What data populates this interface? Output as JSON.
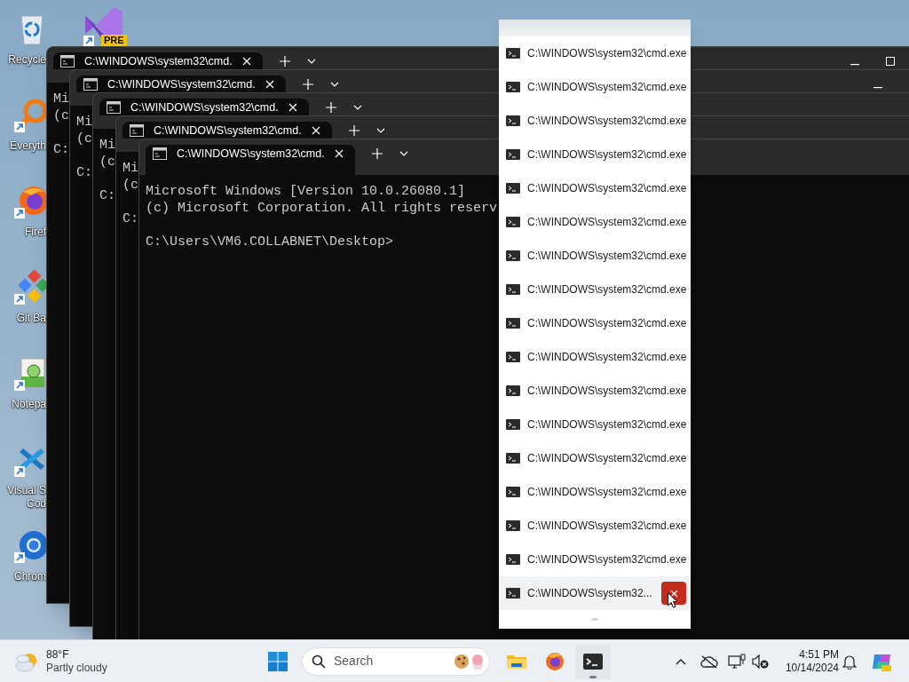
{
  "desktop_icons": [
    {
      "kind": "bin",
      "label": "Recycle",
      "shortcut": false
    },
    {
      "kind": "magnifier",
      "label": "Everyth",
      "shortcut": true
    },
    {
      "kind": "browser",
      "label": "Firef",
      "shortcut": true
    },
    {
      "kind": "git",
      "label": "Git Ba",
      "shortcut": true
    },
    {
      "kind": "notepad",
      "label": "Notepa",
      "shortcut": true
    },
    {
      "kind": "editor",
      "label": "Visual S",
      "label_line_2": "Cod",
      "shortcut": true
    },
    {
      "kind": "globe",
      "label": "Chrom",
      "shortcut": true
    }
  ],
  "second_column_icons": [
    {
      "kind": "studio",
      "badge": "PRE",
      "shortcut": true
    }
  ],
  "terminal_windows": [
    {
      "tab_title": "C:\\WINDOWS\\system32\\cmd.",
      "lines": [
        {
          "kind": "output",
          "text": "Mi"
        },
        {
          "kind": "output",
          "text": "(c"
        },
        {
          "kind": "prompt",
          "text": "C:"
        }
      ]
    },
    {
      "tab_title": "C:\\WINDOWS\\system32\\cmd.",
      "lines": [
        {
          "kind": "output",
          "text": "Mi"
        },
        {
          "kind": "output",
          "text": "(c"
        },
        {
          "kind": "prompt",
          "text": "C:"
        }
      ]
    },
    {
      "tab_title": "C:\\WINDOWS\\system32\\cmd.",
      "lines": [
        {
          "kind": "output",
          "text": "Mi"
        },
        {
          "kind": "output",
          "text": "(c"
        },
        {
          "kind": "prompt",
          "text": "C:"
        }
      ]
    },
    {
      "tab_title": "C:\\WINDOWS\\system32\\cmd.",
      "lines": [
        {
          "kind": "output",
          "text": "Mi"
        },
        {
          "kind": "output",
          "text": "(c"
        },
        {
          "kind": "prompt",
          "text": "C:"
        }
      ]
    },
    {
      "tab_title": "C:\\WINDOWS\\system32\\cmd.",
      "lines": [
        {
          "kind": "output",
          "text": "Microsoft Windows [Version 10.0.26080.1]"
        },
        {
          "kind": "output",
          "text": "(c) Microsoft Corporation. All rights reserv"
        },
        {
          "kind": "prompt",
          "text": "C:\\Users\\VM6.COLLABNET\\Desktop>"
        }
      ]
    }
  ],
  "jump_list": {
    "items": [
      {
        "label": "C:\\WINDOWS\\system32\\cmd.exe",
        "hovered": false
      },
      {
        "label": "C:\\WINDOWS\\system32\\cmd.exe",
        "hovered": false
      },
      {
        "label": "C:\\WINDOWS\\system32\\cmd.exe",
        "hovered": false
      },
      {
        "label": "C:\\WINDOWS\\system32\\cmd.exe",
        "hovered": false
      },
      {
        "label": "C:\\WINDOWS\\system32\\cmd.exe",
        "hovered": false
      },
      {
        "label": "C:\\WINDOWS\\system32\\cmd.exe",
        "hovered": false
      },
      {
        "label": "C:\\WINDOWS\\system32\\cmd.exe",
        "hovered": false
      },
      {
        "label": "C:\\WINDOWS\\system32\\cmd.exe",
        "hovered": false
      },
      {
        "label": "C:\\WINDOWS\\system32\\cmd.exe",
        "hovered": false
      },
      {
        "label": "C:\\WINDOWS\\system32\\cmd.exe",
        "hovered": false
      },
      {
        "label": "C:\\WINDOWS\\system32\\cmd.exe",
        "hovered": false
      },
      {
        "label": "C:\\WINDOWS\\system32\\cmd.exe",
        "hovered": false
      },
      {
        "label": "C:\\WINDOWS\\system32\\cmd.exe",
        "hovered": false
      },
      {
        "label": "C:\\WINDOWS\\system32\\cmd.exe",
        "hovered": false
      },
      {
        "label": "C:\\WINDOWS\\system32\\cmd.exe",
        "hovered": false
      },
      {
        "label": "C:\\WINDOWS\\system32\\cmd.exe",
        "hovered": false
      },
      {
        "label": "C:\\WINDOWS\\system32...",
        "hovered": true
      }
    ]
  },
  "taskbar": {
    "weather": {
      "temperature": "88°F",
      "condition": "Partly cloudy"
    },
    "search": {
      "placeholder": "Search"
    },
    "apps": [
      {
        "kind": "folder",
        "active": false
      },
      {
        "kind": "browser",
        "active": false
      },
      {
        "kind": "terminal",
        "active": true
      }
    ],
    "clock": {
      "time": "4:51 PM",
      "date": "10/14/2024"
    }
  }
}
